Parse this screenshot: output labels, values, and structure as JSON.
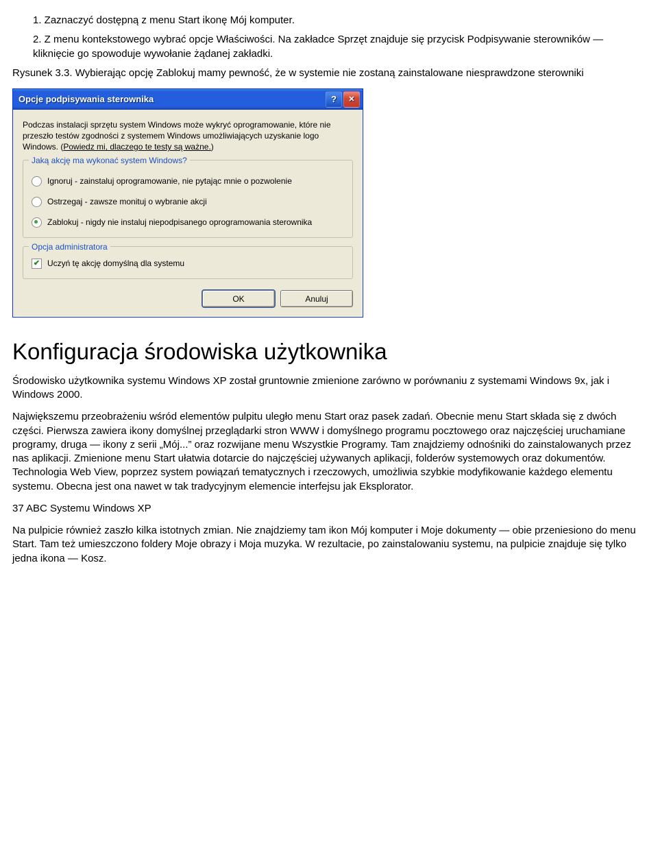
{
  "doc": {
    "list1": "1. Zaznaczyć dostępną z menu Start ikonę Mój komputer.",
    "list2_a": "2. Z menu kontekstowego wybrać opcje ",
    "list2_b": "Właściwości",
    "list2_c": ". Na zakładce ",
    "list2_d": "Sprzęt",
    "list2_e": " znajduje się przycisk ",
    "list2_f": "Podpisywanie sterowników",
    "list2_g": " — kliknięcie go spowoduje wywołanie żądanej zakładki.",
    "caption": "Rysunek 3.3. Wybierając opcję Zablokuj mamy pewność, że w systemie nie zostaną zainstalowane niesprawdzone sterowniki",
    "heading": "Konfiguracja środowiska użytkownika",
    "p1": "Środowisko użytkownika systemu Windows XP został gruntownie zmienione zarówno w porównaniu z systemami Windows 9x, jak i Windows 2000.",
    "p2": "Największemu przeobrażeniu wśród elementów pulpitu uległo menu Start oraz pasek zadań. Obecnie menu Start składa się z dwóch części. Pierwsza zawiera ikony domyślnej przeglądarki stron WWW i domyślnego programu pocztowego oraz najczęściej uruchamiane programy, druga — ikony z serii „Mój...” oraz rozwijane menu Wszystkie Programy. Tam znajdziemy odnośniki do zainstalowanych przez nas aplikacji. Zmienione menu Start ułatwia dotarcie do najczęściej używanych aplikacji, folderów systemowych oraz dokumentów. Technologia Web View, poprzez system powiązań tematycznych i rzeczowych, umożliwia szybkie modyfikowanie każdego elementu systemu. Obecna jest ona nawet w tak tradycyjnym elemencie interfejsu jak Eksplorator.",
    "p3": "37 ABC Systemu Windows XP",
    "p4": "Na pulpicie również zaszło kilka istotnych zmian. Nie znajdziemy tam ikon Mój komputer i Moje dokumenty — obie przeniesiono do menu Start. Tam też umieszczono foldery Moje obrazy i Moja muzyka. W rezultacie, po zainstalowaniu systemu, na pulpicie znajduje się tylko jedna ikona — Kosz."
  },
  "dialog": {
    "title": "Opcje podpisywania sterownika",
    "intro_a": "Podczas instalacji sprzętu system Windows może wykryć oprogramowanie, które nie przeszło testów zgodności z systemem Windows umożliwiających uzyskanie logo Windows. (",
    "intro_link": "Powiedz mi, dlaczego te testy są ważne.",
    "intro_b": ")",
    "group1_legend": "Jaką akcję ma wykonać system Windows?",
    "opt1": "Ignoruj - zainstaluj oprogramowanie, nie pytając mnie o pozwolenie",
    "opt2": "Ostrzegaj - zawsze monituj o wybranie akcji",
    "opt3": "Zablokuj - nigdy nie instaluj niepodpisanego oprogramowania sterownika",
    "group2_legend": "Opcja administratora",
    "check1": "Uczyń tę akcję domyślną dla systemu",
    "btn_ok": "OK",
    "btn_cancel": "Anuluj"
  }
}
